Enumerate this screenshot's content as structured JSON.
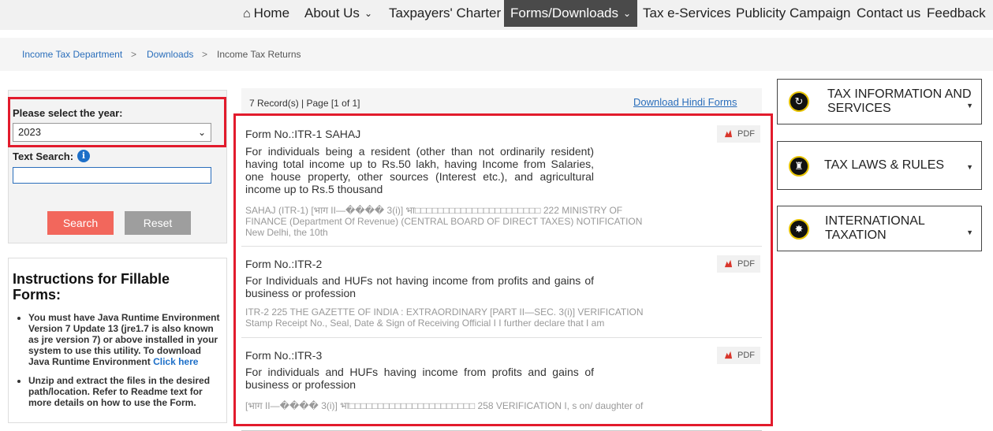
{
  "nav": {
    "home": "Home",
    "about": "About Us",
    "charter": "Taxpayers' Charter",
    "forms": "Forms/Downloads",
    "eservices": "Tax e-Services",
    "publicity": "Publicity Campaign",
    "contact": "Contact us",
    "feedback": "Feedback"
  },
  "breadcrumb": {
    "items": [
      "Income Tax Department",
      "Downloads",
      "Income Tax Returns"
    ],
    "separator": ">"
  },
  "filter": {
    "year_label": "Please select the year:",
    "year_value": "2023",
    "text_search_label": "Text Search:",
    "search_button": "Search",
    "reset_button": "Reset",
    "search_value": ""
  },
  "instructions": {
    "title": "Instructions for Fillable Forms:",
    "item1": "You must have Java Runtime Environment Version 7 Update 13 (jre1.7 is also known as jre version 7) or above installed in your system to use this utility. To download Java Runtime Environment",
    "item1_link": "Click here",
    "item2": "Unzip and extract the files in the desired path/location. Refer to Readme text for more details on how to use the Form."
  },
  "results": {
    "record_summary": "7 Record(s) | Page [1 of 1]",
    "hindi_link": "Download Hindi Forms",
    "pdf_label": "PDF",
    "records": [
      {
        "form_no": "Form No.:ITR-1 SAHAJ",
        "description": "For individuals being a resident (other than not ordinarily resident) having total income up to Rs.50 lakh, having Income from Salaries, one house property, other sources (Interest etc.), and agricultural income up to Rs.5 thousand",
        "snippet": "SAHAJ (ITR-1) [भाग II—���� 3(i)] भा□□□□□□□□□□□□□□□□□□□□□□ 222 MINISTRY OF FINANCE (Department Of Revenue) (CENTRAL BOARD OF DIRECT TAXES) NOTIFICATION New Delhi, the 10th"
      },
      {
        "form_no": "Form No.:ITR-2",
        "description": "For Individuals and HUFs not having income from profits and gains of business or profession",
        "snippet": "ITR-2 225 THE GAZETTE OF INDIA : EXTRAORDINARY [PART II—SEC. 3(i)] VERIFICATION Stamp Receipt No., Seal, Date & Sign of Receiving Official I I further declare that I am"
      },
      {
        "form_no": "Form No.:ITR-3",
        "description": "For individuals and HUFs having income from profits and gains of business or profession",
        "snippet": "[भाग II—���� 3(i)] भा□□□□□□□□□□□□□□□□□□□□□□ 258 VERIFICATION I, s on/ daughter of"
      }
    ]
  },
  "sidebar": {
    "tax_info": "TAX INFORMATION AND SERVICES",
    "tax_laws": "TAX LAWS & RULES",
    "intl": "INTERNATIONAL TAXATION"
  },
  "colors": {
    "highlight": "#e21b2c",
    "search_button": "#f2675c",
    "reset_button": "#9e9e9e",
    "active_nav": "#4a4a4a",
    "link": "#2a6ebb"
  }
}
